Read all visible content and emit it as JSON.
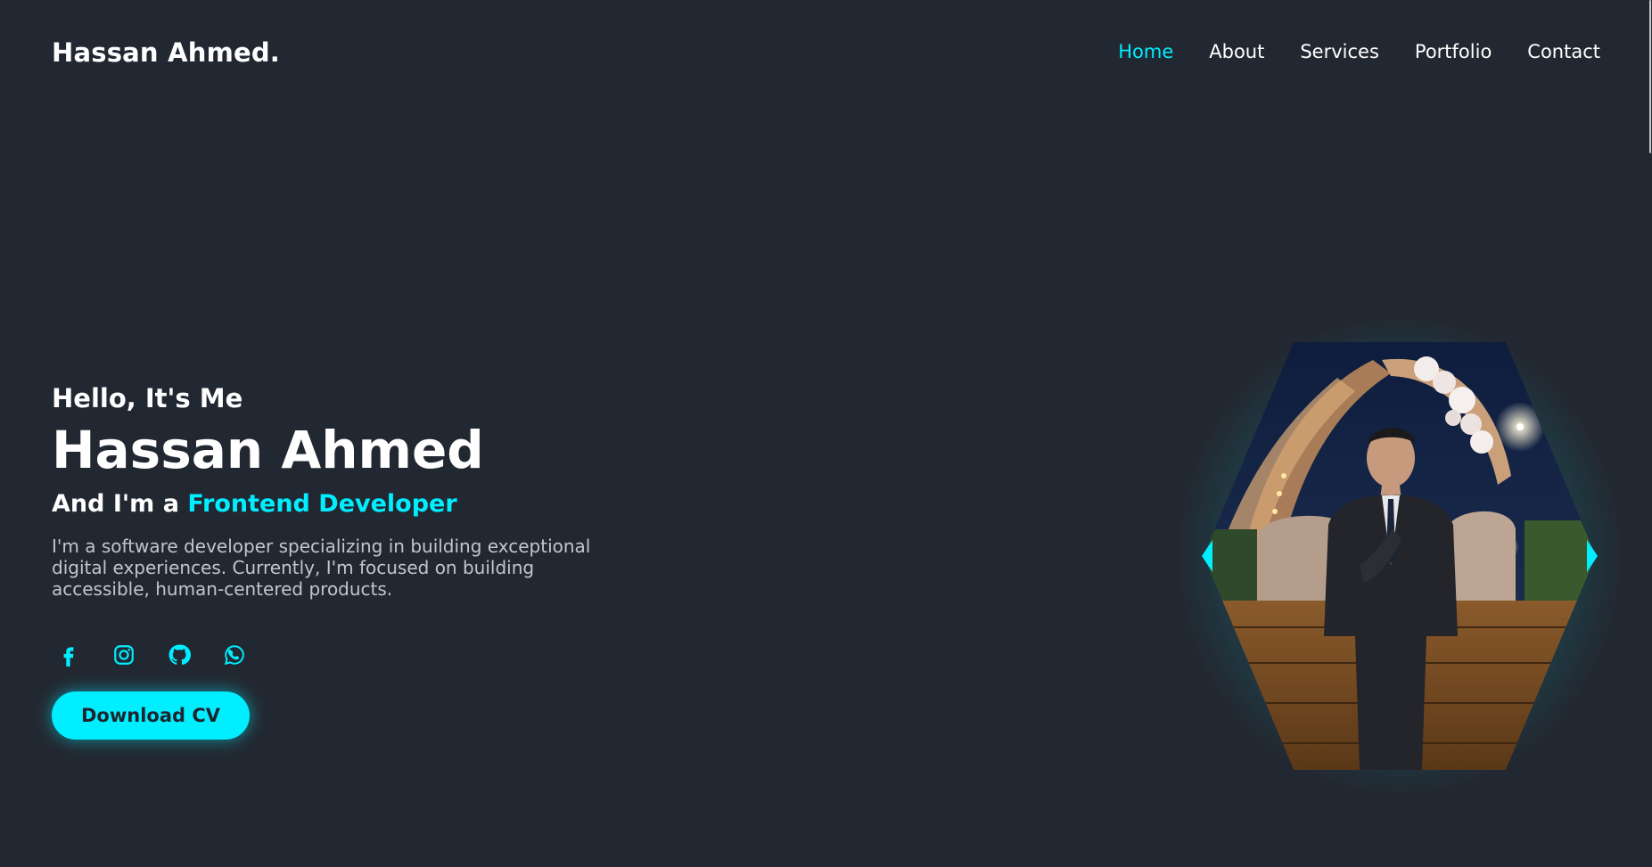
{
  "header": {
    "logo": "Hassan Ahmed.",
    "nav": [
      {
        "label": "Home",
        "active": true
      },
      {
        "label": "About",
        "active": false
      },
      {
        "label": "Services",
        "active": false
      },
      {
        "label": "Portfolio",
        "active": false
      },
      {
        "label": "Contact",
        "active": false
      }
    ]
  },
  "hero": {
    "greeting": "Hello, It's Me",
    "name": "Hassan Ahmed",
    "role_prefix": "And I'm a ",
    "role_title": "Frontend Developer",
    "description": "I'm a software developer specializing in building exceptional digital experiences. Currently, I'm focused on building accessible, human-centered products.",
    "socials": [
      {
        "icon": "facebook-icon"
      },
      {
        "icon": "instagram-icon"
      },
      {
        "icon": "github-icon"
      },
      {
        "icon": "whatsapp-icon"
      }
    ],
    "cv_button": "Download CV"
  },
  "colors": {
    "background": "#222831",
    "accent": "#00eeff",
    "text": "#ffffff",
    "muted": "#c2c6cc"
  },
  "photo": {
    "shape": "hexagon",
    "subject": "man in dark suit at night venue"
  }
}
